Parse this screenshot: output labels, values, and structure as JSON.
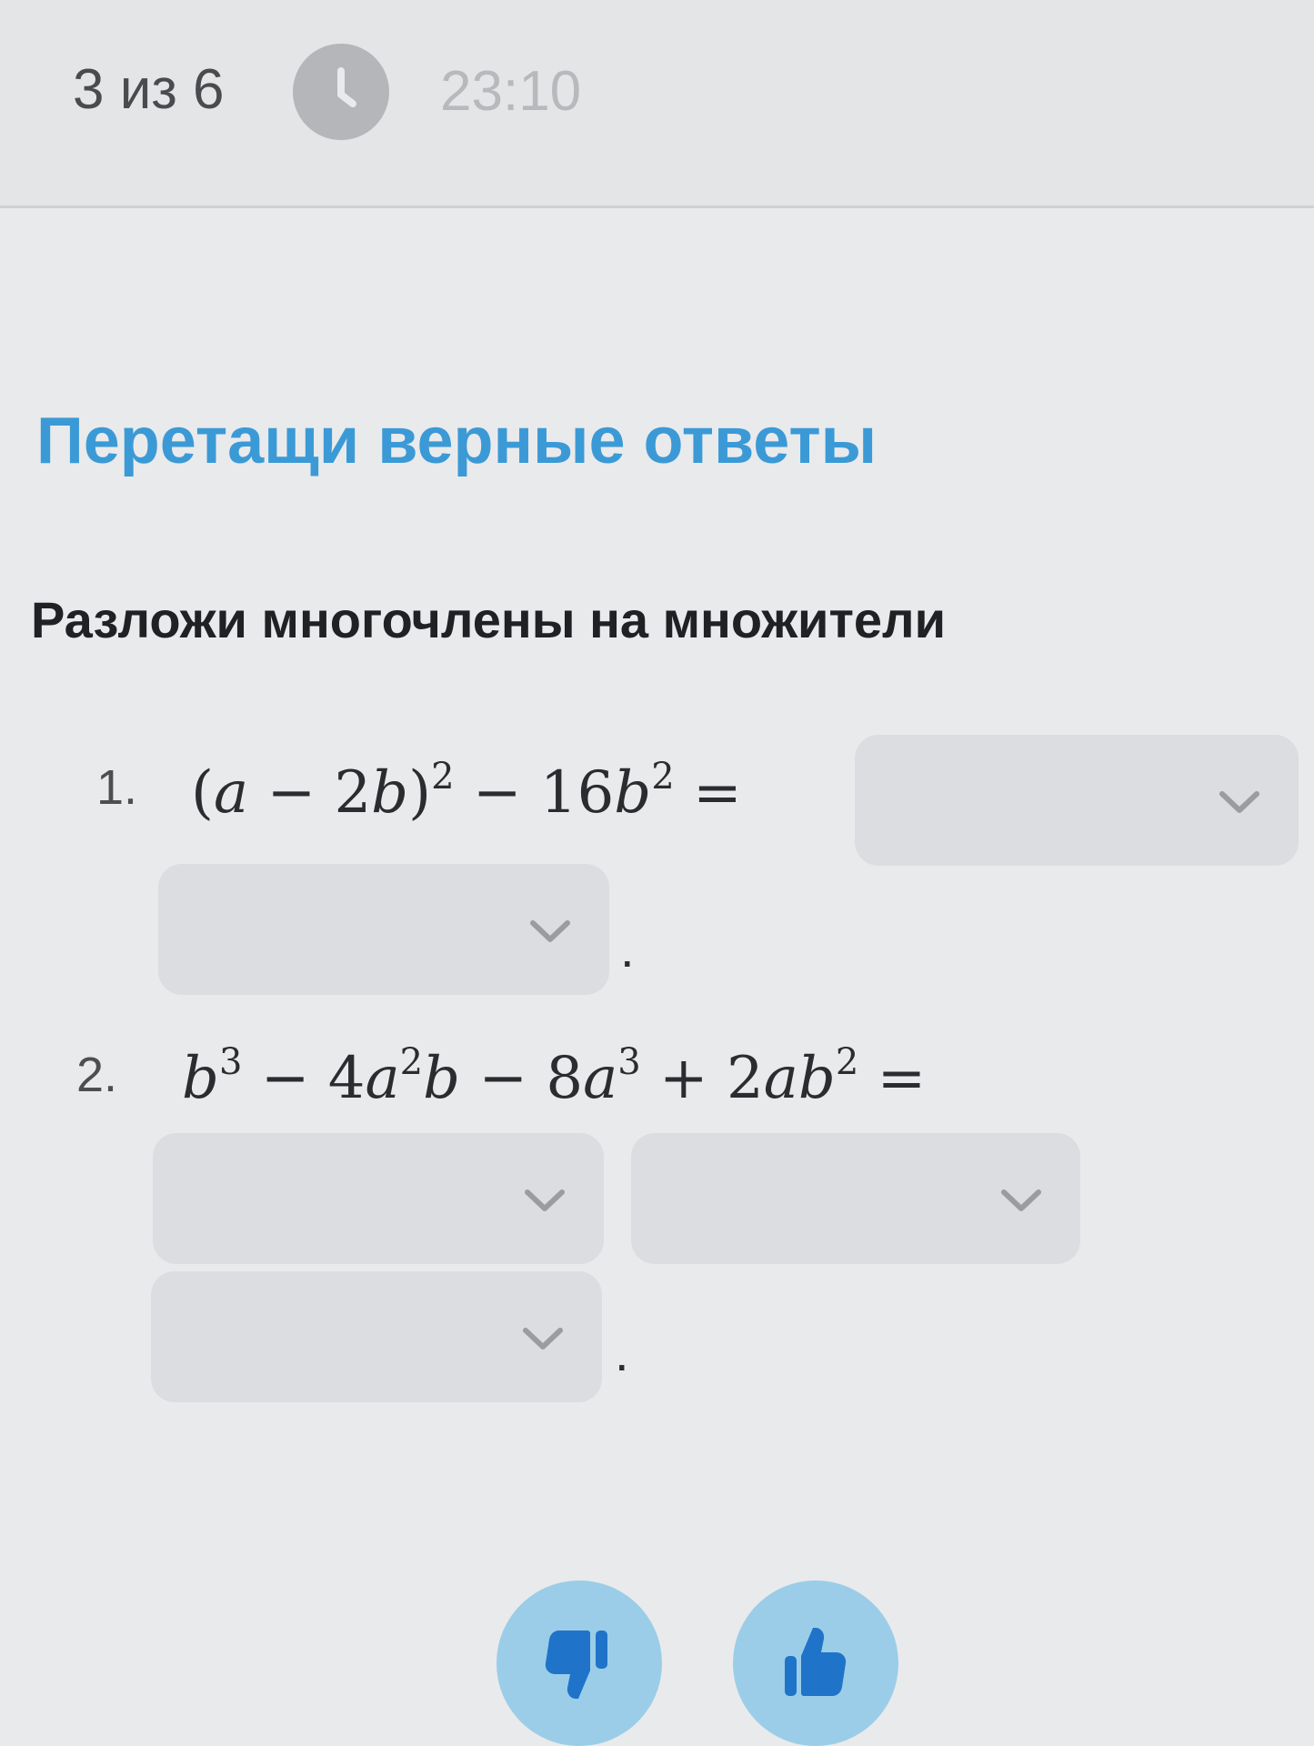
{
  "header": {
    "counter": "3 из 6",
    "timer": "23:10",
    "timer_icon": "clock-icon"
  },
  "title": "Перетащи верные ответы",
  "task": "Разложи многочлены на множители",
  "problems": [
    {
      "number": "1.",
      "expression": "(a − 2b)² − 16b² =",
      "answer_slots": 2,
      "terminator": "."
    },
    {
      "number": "2.",
      "expression": "b³ − 4a²b − 8a³ + 2ab² =",
      "answer_slots": 3,
      "terminator": "."
    }
  ],
  "feedback": {
    "dislike_icon": "thumbs-down-icon",
    "like_icon": "thumbs-up-icon",
    "button_color": "#9bcde8",
    "icon_color": "#1f74c9"
  },
  "colors": {
    "accent": "#3b9ad6",
    "dropdown_bg": "#dcdde0",
    "background": "#e9eaec"
  }
}
